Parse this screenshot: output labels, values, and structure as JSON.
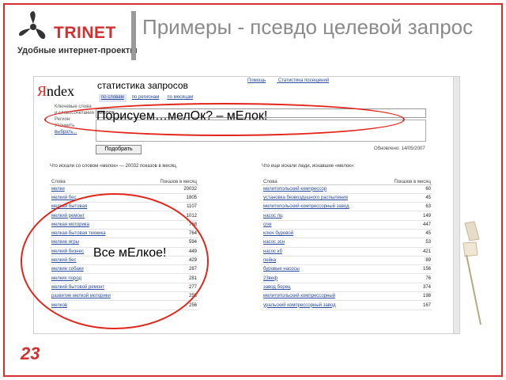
{
  "slide": {
    "title": "Примеры -  псевдо целевой запрос",
    "page_number": "23",
    "brand_color": "#d3302f"
  },
  "logo": {
    "name": "TRINET",
    "tagline": "Удобные интернет-проекты",
    "icon": "propeller-logo-icon"
  },
  "screenshot": {
    "yandex_logo": "Яndex",
    "page_title": "статистика запросов",
    "top_links": [
      "Помощь",
      "Статистика посещений"
    ],
    "tabs": [
      "по словам",
      "по регионам",
      "по месяцам"
    ],
    "form_labels": [
      "Ключевые слова",
      "и словосочетания",
      "Регион:",
      "Уточнить",
      "выбрать..."
    ],
    "query_value": "мелок",
    "pick_button": "Подобрать",
    "updated": "Обновлено: 14/05/2007",
    "left_table": {
      "caption": "Что искали со словом «мелок» — 20032 показов в месяц.",
      "col_word": "Слова",
      "col_shows": "Показов в месяц",
      "rows": [
        {
          "word": "мелки",
          "shows": "20032"
        },
        {
          "word": "мелкий бес",
          "shows": "1805"
        },
        {
          "word": "мелкая бытовая",
          "shows": "1107"
        },
        {
          "word": "мелкий ремонт",
          "shows": "1012"
        },
        {
          "word": "мелкая моторика",
          "shows": "768"
        },
        {
          "word": "мелкая бытовая техника",
          "shows": "764"
        },
        {
          "word": "мелкие игры",
          "shows": "594"
        },
        {
          "word": "мелкий бизнес",
          "shows": "449"
        },
        {
          "word": "мелкий бес",
          "shows": "429"
        },
        {
          "word": "мелкие собаки",
          "shows": "287"
        },
        {
          "word": "мелких пород",
          "shows": "281"
        },
        {
          "word": "мелкий бытовой ремонт",
          "shows": "277"
        },
        {
          "word": "развитие мелкой моторики",
          "shows": "258"
        },
        {
          "word": "мелков",
          "shows": "256"
        }
      ]
    },
    "right_table": {
      "caption": "Что еще искали люди, искавшие «мелок»:",
      "col_word": "Слова",
      "col_shows": "Показов в месяц",
      "rows": [
        {
          "word": "мелитопольский компрессор",
          "shows": "60"
        },
        {
          "word": "установка безвоздушного распыления",
          "shows": "45"
        },
        {
          "word": "мелитопольский компрессорный завод",
          "shows": "63"
        },
        {
          "word": "насос пц",
          "shows": "149"
        },
        {
          "word": "сгкк",
          "shows": "447"
        },
        {
          "word": "ключ буровой",
          "shows": "45"
        },
        {
          "word": "насос эсн",
          "shows": "53"
        },
        {
          "word": "насос кб",
          "shows": "421"
        },
        {
          "word": "пейка",
          "shows": "89"
        },
        {
          "word": "буровые насосы",
          "shows": "156"
        },
        {
          "word": "23веф",
          "shows": "76"
        },
        {
          "word": "завод борец",
          "shows": "374"
        },
        {
          "word": "мелитопольский компрессорный",
          "shows": "198"
        },
        {
          "word": "уральский компрессорный завод",
          "shows": "167"
        }
      ]
    }
  },
  "annotations": {
    "note_top": "Порисуем…мелОк? – мЕлок!",
    "note_bottom": "Все мЕлкое!",
    "ellipse_color": "#e2261b"
  }
}
